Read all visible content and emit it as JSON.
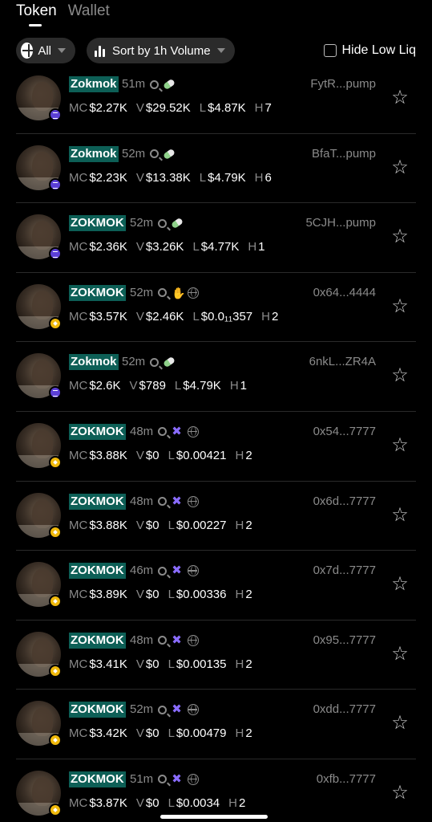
{
  "tabs": [
    {
      "label": "Token",
      "active": true
    },
    {
      "label": "Wallet",
      "active": false
    }
  ],
  "filters": {
    "all_label": "All",
    "sort_label": "Sort by 1h Volume",
    "hide_low_liq_label": "Hide Low Liq",
    "hide_low_liq_checked": false
  },
  "stat_labels": {
    "mc": "MC",
    "v": "V",
    "l": "L",
    "h": "H"
  },
  "tokens": [
    {
      "name": "Zokmok",
      "age": "51m",
      "chain": "sol",
      "icons": [
        "search-icon",
        "pill-icon"
      ],
      "address": "FytR...pump",
      "mc": "$2.27K",
      "v": "$29.52K",
      "l": "$4.87K",
      "h": "7"
    },
    {
      "name": "Zokmok",
      "age": "52m",
      "chain": "sol",
      "icons": [
        "search-icon",
        "pill-icon"
      ],
      "address": "BfaT...pump",
      "mc": "$2.23K",
      "v": "$13.38K",
      "l": "$4.79K",
      "h": "6"
    },
    {
      "name": "ZOKMOK",
      "age": "52m",
      "chain": "sol",
      "icons": [
        "search-icon",
        "pill-icon"
      ],
      "address": "5CJH...pump",
      "mc": "$2.36K",
      "v": "$3.26K",
      "l": "$4.77K",
      "h": "1"
    },
    {
      "name": "ZOKMOK",
      "age": "52m",
      "chain": "bnb",
      "icons": [
        "search-icon",
        "hand-icon",
        "globe-icon"
      ],
      "address": "0x64...4444",
      "mc": "$3.57K",
      "v": "$2.46K",
      "l": "$0.0₁₁357",
      "h": "2"
    },
    {
      "name": "Zokmok",
      "age": "52m",
      "chain": "sol",
      "icons": [
        "search-icon",
        "pill-icon"
      ],
      "address": "6nkL...ZR4A",
      "mc": "$2.6K",
      "v": "$789",
      "l": "$4.79K",
      "h": "1"
    },
    {
      "name": "ZOKMOK",
      "age": "48m",
      "chain": "bnb",
      "icons": [
        "search-icon",
        "x-icon",
        "globe-icon"
      ],
      "address": "0x54...7777",
      "mc": "$3.88K",
      "v": "$0",
      "l": "$0.00421",
      "h": "2"
    },
    {
      "name": "ZOKMOK",
      "age": "48m",
      "chain": "bnb",
      "icons": [
        "search-icon",
        "x-icon",
        "globe-icon"
      ],
      "address": "0x6d...7777",
      "mc": "$3.88K",
      "v": "$0",
      "l": "$0.00227",
      "h": "2"
    },
    {
      "name": "ZOKMOK",
      "age": "46m",
      "chain": "bnb",
      "icons": [
        "search-icon",
        "x-icon",
        "globe-icon"
      ],
      "address": "0x7d...7777",
      "mc": "$3.89K",
      "v": "$0",
      "l": "$0.00336",
      "h": "2"
    },
    {
      "name": "ZOKMOK",
      "age": "48m",
      "chain": "bnb",
      "icons": [
        "search-icon",
        "x-icon",
        "globe-icon"
      ],
      "address": "0x95...7777",
      "mc": "$3.41K",
      "v": "$0",
      "l": "$0.00135",
      "h": "2"
    },
    {
      "name": "ZOKMOK",
      "age": "52m",
      "chain": "bnb",
      "icons": [
        "search-icon",
        "x-icon",
        "globe-icon"
      ],
      "address": "0xdd...7777",
      "mc": "$3.42K",
      "v": "$0",
      "l": "$0.00479",
      "h": "2"
    },
    {
      "name": "ZOKMOK",
      "age": "51m",
      "chain": "bnb",
      "icons": [
        "search-icon",
        "x-icon",
        "globe-icon"
      ],
      "address": "0xfb...7777",
      "mc": "$3.87K",
      "v": "$0",
      "l": "$0.0034",
      "h": "2"
    }
  ],
  "colors": {
    "background": "#000000",
    "name_highlight": "#0d5f56",
    "sol_badge": "#5b3fd6",
    "bnb_badge": "#f0b90b",
    "muted": "#8a8a8a"
  }
}
